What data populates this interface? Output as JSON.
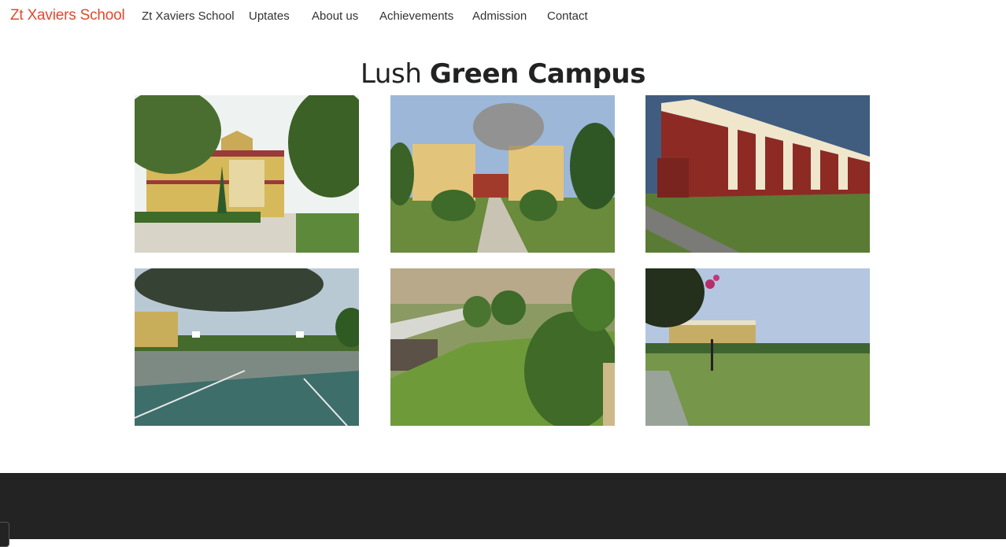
{
  "navbar": {
    "brand": "Zt Xaviers School",
    "items": [
      {
        "label": "Zt Xaviers School"
      },
      {
        "label": "Uptates"
      },
      {
        "label": "About us"
      },
      {
        "label": "Achievements"
      },
      {
        "label": "Admission"
      },
      {
        "label": "Contact"
      }
    ]
  },
  "gallery": {
    "heading_light": "Lush",
    "heading_bold": "Green Campus",
    "photos": [
      {
        "icon": "campus-building-photo"
      },
      {
        "icon": "campus-walkway-photo"
      },
      {
        "icon": "campus-red-building-photo"
      },
      {
        "icon": "basketball-court-photo"
      },
      {
        "icon": "garden-lawn-photo"
      },
      {
        "icon": "playground-field-photo"
      }
    ]
  },
  "colors": {
    "brand": "#e0492f",
    "nav_text": "#333333",
    "heading": "#222222",
    "footer": "#232323"
  }
}
